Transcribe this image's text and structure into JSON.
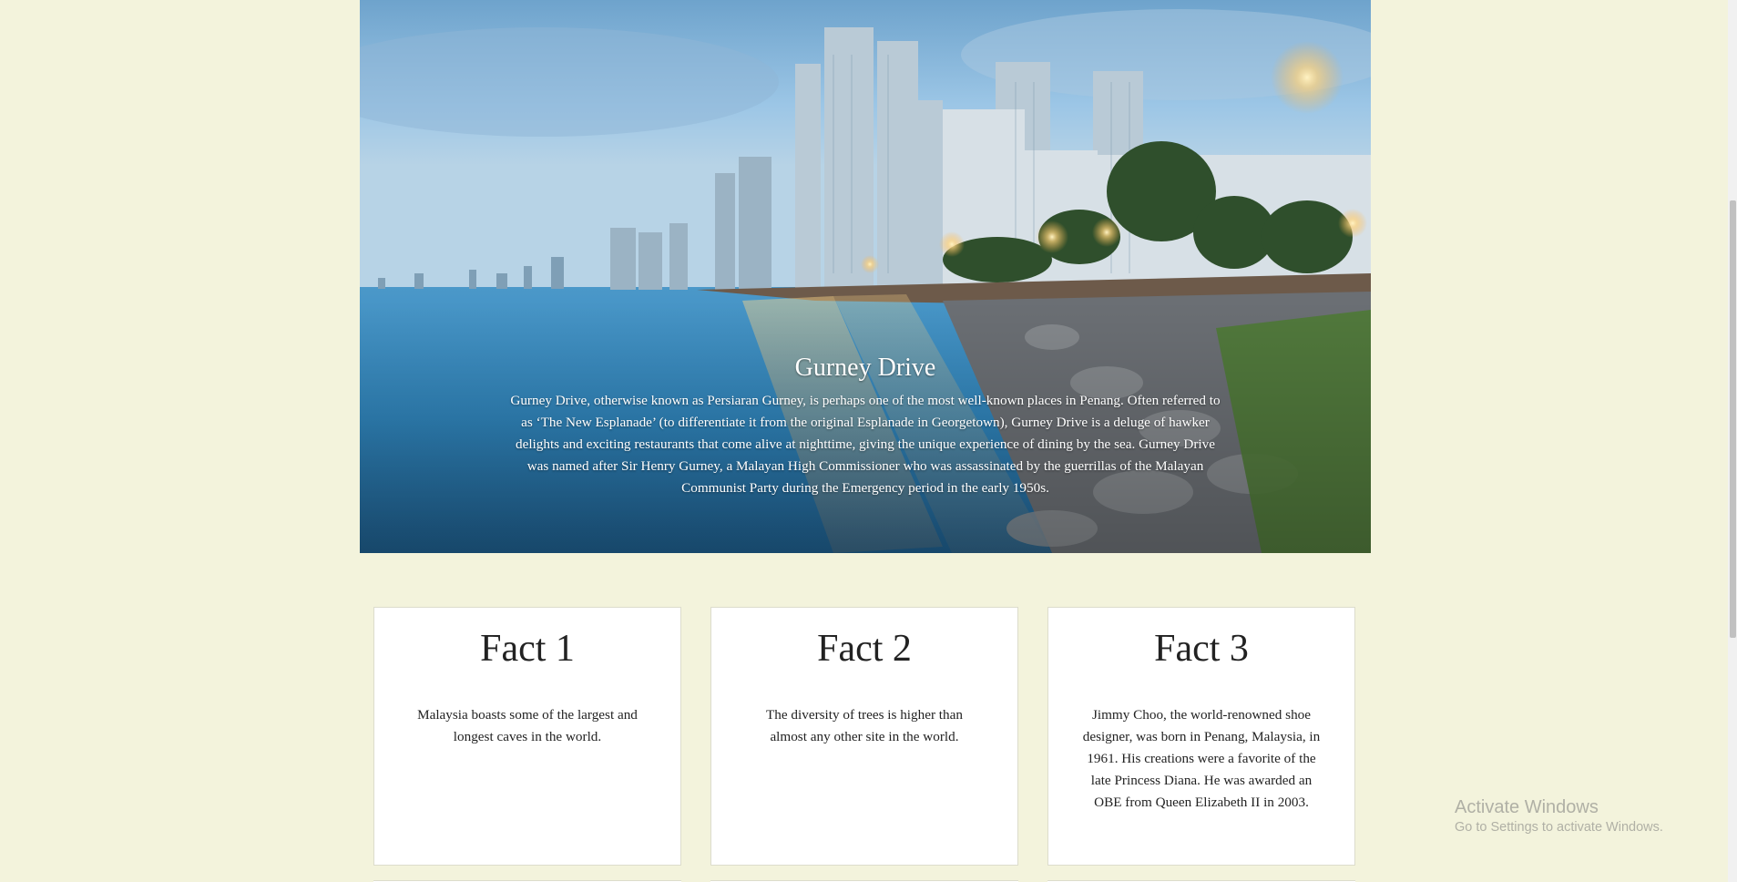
{
  "hero": {
    "title": "Gurney Drive",
    "description": "Gurney Drive, otherwise known as Persiaran Gurney, is perhaps one of the most well-known places in Penang. Often referred to as ‘The New Esplanade’ (to differentiate it from the original Esplanade in Georgetown), Gurney Drive is a deluge of hawker delights and exciting restaurants that come alive at nighttime, giving the unique experience of dining by the sea. Gurney Drive was named after Sir Henry Gurney, a Malayan High Commissioner who was assassinated by the guerrillas of the Malayan Communist Party during the Emergency period in the early 1950s."
  },
  "facts": [
    {
      "title": "Fact 1",
      "text": "Malaysia boasts some of the largest and longest caves in the world."
    },
    {
      "title": "Fact 2",
      "text": "The diversity of trees is higher than almost any other site in the world."
    },
    {
      "title": "Fact 3",
      "text": "Jimmy Choo, the world-renowned shoe designer, was born in Penang, Malaysia, in 1961. His creations were a favorite of the late Princess Diana. He was awarded an OBE from Queen Elizabeth II in 2003."
    }
  ],
  "watermark": {
    "title": "Activate Windows",
    "subtitle": "Go to Settings to activate Windows."
  },
  "colors": {
    "page_background": "#f3f3dc",
    "card_background": "#ffffff",
    "hero_text": "#ffffff"
  }
}
